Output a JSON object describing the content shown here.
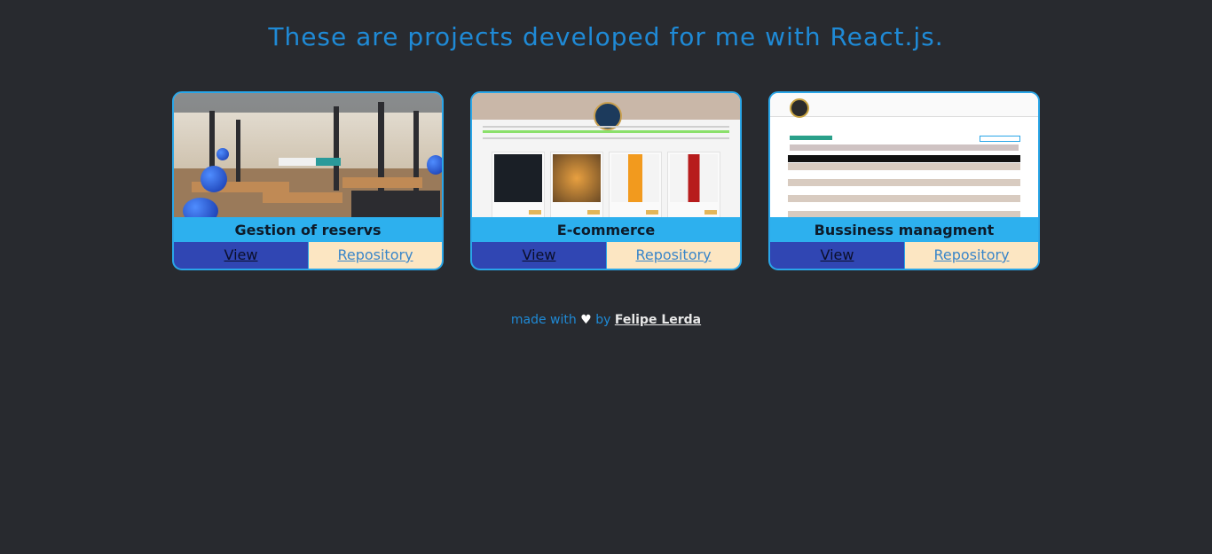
{
  "header": {
    "title": "These are projects developed for me with React.js."
  },
  "projects": [
    {
      "title": "Gestion of reservs",
      "view_label": "View",
      "repo_label": "Repository"
    },
    {
      "title": "E-commerce",
      "view_label": "View",
      "repo_label": "Repository"
    },
    {
      "title": "Bussiness managment",
      "view_label": "View",
      "repo_label": "Repository"
    }
  ],
  "footer": {
    "prefix": "made with",
    "heart": "♥",
    "by": "by",
    "author": "Felipe Lerda"
  },
  "colors": {
    "background": "#282a2f",
    "accent": "#1f8ad6",
    "card": "#2db0ee",
    "view_button": "#3046b3",
    "repo_button": "#fce6c2"
  }
}
